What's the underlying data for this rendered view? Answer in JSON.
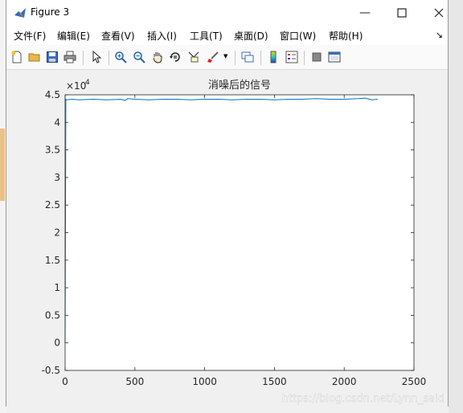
{
  "window": {
    "title": "Figure 3"
  },
  "menu": [
    {
      "label": "文件(F)"
    },
    {
      "label": "编辑(E)"
    },
    {
      "label": "查看(V)"
    },
    {
      "label": "插入(I)"
    },
    {
      "label": "工具(T)"
    },
    {
      "label": "桌面(D)"
    },
    {
      "label": "窗口(W)"
    },
    {
      "label": "帮助(H)"
    }
  ],
  "toolbar_icons": [
    "new-figure-icon",
    "open-folder-icon",
    "save-icon",
    "print-icon",
    "pointer-icon",
    "zoom-in-icon",
    "zoom-out-icon",
    "pan-hand-icon",
    "rotate-3d-icon",
    "data-cursor-icon",
    "brush-icon",
    "link-plot-icon",
    "colorbar-icon",
    "legend-icon",
    "hide-plot-tools-icon",
    "show-plot-tools-icon"
  ],
  "watermark": "https://blog.csdn.net/Lynn_said",
  "colors": {
    "line": "#0072bd",
    "axes_bg": "#ffffff",
    "figure_bg": "#f0f0f0"
  },
  "chart_data": {
    "type": "line",
    "title": "消噪后的信号",
    "exponent_label": "×10",
    "exponent_power": "4",
    "xlim": [
      0,
      2500
    ],
    "ylim": [
      -0.5,
      4.5
    ],
    "x_ticks": [
      0,
      500,
      1000,
      1500,
      2000,
      2500
    ],
    "x_tick_labels": [
      "0",
      "500",
      "1000",
      "1500",
      "2000",
      "2500"
    ],
    "y_ticks": [
      -0.5,
      0,
      0.5,
      1,
      1.5,
      2,
      2.5,
      3,
      3.5,
      4,
      4.5
    ],
    "y_tick_labels": [
      "-0.5",
      "0",
      "0.5",
      "1",
      "1.5",
      "2",
      "2.5",
      "3",
      "3.5",
      "4",
      "4.5"
    ],
    "series": [
      {
        "x": [
          0,
          5,
          10,
          50,
          100,
          200,
          300,
          400,
          430,
          450,
          500,
          600,
          700,
          800,
          900,
          1000,
          1100,
          1200,
          1300,
          1400,
          1500,
          1600,
          1700,
          1800,
          1900,
          2000,
          2100,
          2150,
          2200,
          2240
        ],
        "y": [
          0,
          4.42,
          4.41,
          4.42,
          4.41,
          4.42,
          4.41,
          4.42,
          4.4,
          4.43,
          4.42,
          4.41,
          4.42,
          4.42,
          4.41,
          4.42,
          4.42,
          4.41,
          4.42,
          4.42,
          4.41,
          4.42,
          4.42,
          4.43,
          4.42,
          4.42,
          4.43,
          4.44,
          4.41,
          4.42
        ]
      }
    ],
    "grid": false
  }
}
